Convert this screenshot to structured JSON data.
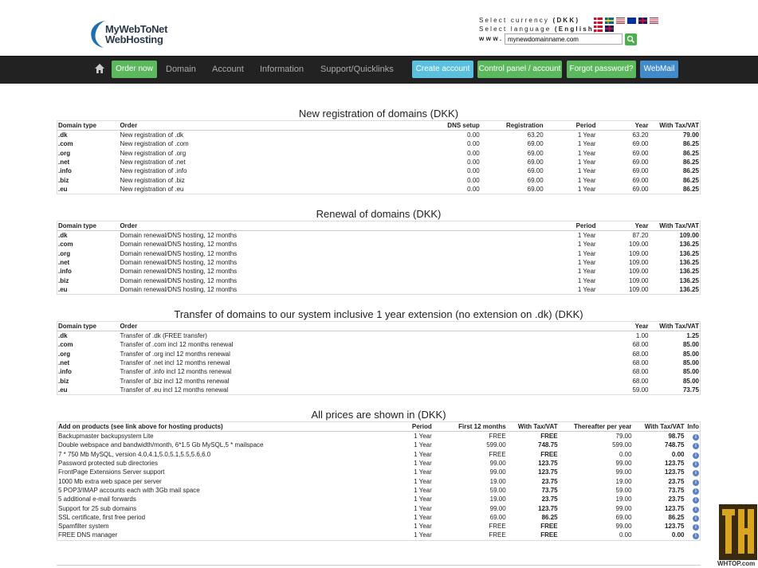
{
  "header": {
    "logo_line1": "MyWebToNet",
    "logo_line2": "WebHosting",
    "currency_label": "Select currency",
    "currency_value": "(DKK)",
    "language_label": "Select language",
    "language_value": "(English)",
    "www_label": "www.",
    "domain_input_value": "mynewdomainname.com"
  },
  "nav": {
    "order_now": "Order now",
    "domain": "Domain",
    "account": "Account",
    "information": "Information",
    "support": "Support/Quicklinks",
    "create_account": "Create account",
    "control_panel": "Control panel / account",
    "forgot_password": "Forgot password?",
    "webmail": "WebMail"
  },
  "registration": {
    "title": "New registration of domains (DKK)",
    "headers": [
      "Domain type",
      "Order",
      "DNS setup",
      "Registration",
      "Period",
      "Year",
      "With Tax/VAT"
    ],
    "rows": [
      [
        ".dk",
        "New registration of .dk",
        "0.00",
        "63.20",
        "1 Year",
        "63.20",
        "79.00"
      ],
      [
        ".com",
        "New registration of .com",
        "0.00",
        "69.00",
        "1 Year",
        "69.00",
        "86.25"
      ],
      [
        ".org",
        "New registration of .org",
        "0.00",
        "69.00",
        "1 Year",
        "69.00",
        "86.25"
      ],
      [
        ".net",
        "New registration of .net",
        "0.00",
        "69.00",
        "1 Year",
        "69.00",
        "86.25"
      ],
      [
        ".info",
        "New registration of .info",
        "0.00",
        "69.00",
        "1 Year",
        "69.00",
        "86.25"
      ],
      [
        ".biz",
        "New registration of .biz",
        "0.00",
        "69.00",
        "1 Year",
        "69.00",
        "86.25"
      ],
      [
        ".eu",
        "New registration of .eu",
        "0.00",
        "69.00",
        "1 Year",
        "69.00",
        "86.25"
      ]
    ]
  },
  "renewal": {
    "title": "Renewal of domains (DKK)",
    "headers": [
      "Domain type",
      "Order",
      "Period",
      "Year",
      "With Tax/VAT"
    ],
    "rows": [
      [
        ".dk",
        "Domain renewal/DNS hosting, 12 months",
        "1 Year",
        "87.20",
        "109.00"
      ],
      [
        ".com",
        "Domain renewal/DNS hosting, 12 months",
        "1 Year",
        "109.00",
        "136.25"
      ],
      [
        ".org",
        "Domain renewal/DNS hosting, 12 months",
        "1 Year",
        "109.00",
        "136.25"
      ],
      [
        ".net",
        "Domain renewal/DNS hosting, 12 months",
        "1 Year",
        "109.00",
        "136.25"
      ],
      [
        ".info",
        "Domain renewal/DNS hosting, 12 months",
        "1 Year",
        "109.00",
        "136.25"
      ],
      [
        ".biz",
        "Domain renewal/DNS hosting, 12 months",
        "1 Year",
        "109.00",
        "136.25"
      ],
      [
        ".eu",
        "Domain renewal/DNS hosting, 12 months",
        "1 Year",
        "109.00",
        "136.25"
      ]
    ]
  },
  "transfer": {
    "title": "Transfer of domains to our system inclusive 1 year extension (no extension on .dk) (DKK)",
    "headers": [
      "Domain type",
      "Order",
      "Year",
      "With Tax/VAT"
    ],
    "rows": [
      [
        ".dk",
        "Transfer of .dk (FREE transfer)",
        "1.00",
        "1.25"
      ],
      [
        ".com",
        "Transfer of .com incl 12 months renewal",
        "68.00",
        "85.00"
      ],
      [
        ".org",
        "Transfer of .org incl 12 months renewal",
        "68.00",
        "85.00"
      ],
      [
        ".net",
        "Transfer of .net incl 12 months renewal",
        "68.00",
        "85.00"
      ],
      [
        ".info",
        "Transfer of .info incl 12 months renewal",
        "68.00",
        "85.00"
      ],
      [
        ".biz",
        "Transfer of .biz incl 12 months renewal",
        "68.00",
        "85.00"
      ],
      [
        ".eu",
        "Transfer of .eu incl 12 months renewal",
        "59.00",
        "73.75"
      ]
    ]
  },
  "addons": {
    "title": "All prices are shown in (DKK)",
    "headers": [
      "Add on products (see link above for hosting products)",
      "Period",
      "First 12 months",
      "With Tax/VAT",
      "Thereafter per year",
      "With Tax/VAT",
      "Info"
    ],
    "rows": [
      [
        "Backupmaster backupsystem Lite",
        "1 Year",
        "FREE",
        "FREE",
        "79.00",
        "98.75"
      ],
      [
        "Double webspace and bandwidth/month, 6*1.5 Gb MySQL,5 * mailspace",
        "1 Year",
        "599.00",
        "748.75",
        "599.00",
        "748.75"
      ],
      [
        "7 * 750 Mb MySQL, version 4.0,4.1,5.0,5.1,5.5,5.6,6.0",
        "1 Year",
        "FREE",
        "FREE",
        "0.00",
        "0.00"
      ],
      [
        "Password protected sub directories",
        "1 Year",
        "99.00",
        "123.75",
        "99.00",
        "123.75"
      ],
      [
        "FrontPage Extensions Server support",
        "1 Year",
        "99.00",
        "123.75",
        "99.00",
        "123.75"
      ],
      [
        "1000 Mb extra web space per server",
        "1 Year",
        "19.00",
        "23.75",
        "19.00",
        "23.75"
      ],
      [
        "5 POP3/IMAP accounts each with 3Gb mail space",
        "1 Year",
        "59.00",
        "73.75",
        "59.00",
        "73.75"
      ],
      [
        "5 additional e-mail forwards",
        "1 Year",
        "19.00",
        "23.75",
        "19.00",
        "23.75"
      ],
      [
        "Support for 25 sub domains",
        "1 Year",
        "99.00",
        "123.75",
        "99.00",
        "123.75"
      ],
      [
        "SSL certificate, first free period",
        "1 Year",
        "69.00",
        "86.25",
        "69.00",
        "86.25"
      ],
      [
        "Spamfilter system",
        "1 Year",
        "FREE",
        "FREE",
        "99.00",
        "123.75"
      ],
      [
        "FREE DNS manager",
        "1 Year",
        "FREE",
        "FREE",
        "0.00",
        "0.00"
      ]
    ]
  },
  "watermark_text": "WHTOP.com"
}
